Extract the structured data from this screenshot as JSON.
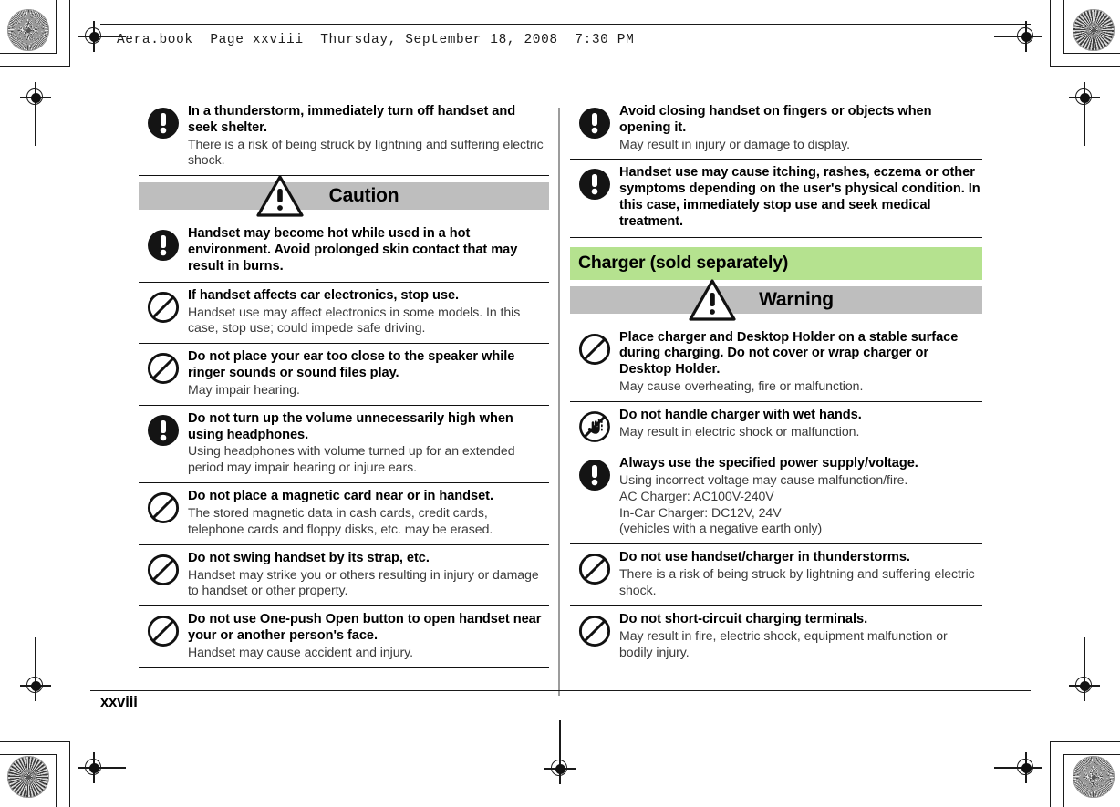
{
  "page": {
    "file_header": "Aera.book  Page xxviii  Thursday, September 18, 2008  7:30 PM",
    "folio": "xxviii"
  },
  "left_column": {
    "entries_top": [
      {
        "icon": "mandatory-exclamation-icon",
        "title": "In a thunderstorm, immediately turn off handset and seek shelter.",
        "desc": "There is a risk of being struck by lightning and suffering electric shock."
      }
    ],
    "caution_bar": {
      "label": "Caution",
      "icon": "caution-triangle-icon",
      "background": "#bebebe"
    },
    "entries_caution": [
      {
        "icon": "mandatory-exclamation-icon",
        "title": "Handset may become hot while used in a hot environment. Avoid prolonged skin contact that may result in burns.",
        "desc": ""
      },
      {
        "icon": "prohibition-icon",
        "title": "If handset affects car electronics, stop use.",
        "desc": "Handset use may affect electronics in some models. In this case, stop use; could impede safe driving."
      },
      {
        "icon": "prohibition-icon",
        "title": "Do not place your ear too close to the speaker while ringer sounds or sound files play.",
        "desc": "May impair hearing."
      },
      {
        "icon": "mandatory-exclamation-icon",
        "title": "Do not turn up the volume unnecessarily high when using headphones.",
        "desc": "Using headphones with volume turned up for an extended period may impair hearing or injure ears."
      },
      {
        "icon": "prohibition-icon",
        "title": "Do not place a magnetic card near or in handset.",
        "desc": "The stored magnetic data in cash cards, credit cards, telephone cards and floppy disks, etc. may be erased."
      },
      {
        "icon": "prohibition-icon",
        "title": "Do not swing handset by its strap, etc.",
        "desc": "Handset may strike you or others resulting in injury or damage to handset or other property."
      },
      {
        "icon": "prohibition-icon",
        "title": "Do not use One-push Open button to open handset near your or another person's face.",
        "desc": "Handset may cause accident and injury."
      }
    ]
  },
  "right_column": {
    "entries_top": [
      {
        "icon": "mandatory-exclamation-icon",
        "title": "Avoid closing handset on fingers or objects when opening it.",
        "desc": "May result in injury or damage to display."
      },
      {
        "icon": "mandatory-exclamation-icon",
        "title": "Handset use may cause itching, rashes, eczema or other symptoms depending on the user's physical condition. In this case, immediately stop use and seek medical treatment.",
        "desc": ""
      }
    ],
    "section_bar": {
      "label": "Charger (sold separately)",
      "background": "#b5e28f"
    },
    "warning_bar": {
      "label": "Warning",
      "icon": "caution-triangle-icon",
      "background": "#bebebe"
    },
    "entries_warning": [
      {
        "icon": "prohibition-icon",
        "title": "Place charger and Desktop Holder on a stable surface during charging. Do not cover or wrap charger or Desktop Holder.",
        "desc": "May cause overheating, fire or malfunction."
      },
      {
        "icon": "wet-hands-prohibition-icon",
        "title": "Do not handle charger with wet hands.",
        "desc": "May result in electric shock or malfunction."
      },
      {
        "icon": "mandatory-exclamation-icon",
        "title": "Always use the specified power supply/voltage.",
        "desc": "Using incorrect voltage may cause malfunction/fire.\nAC Charger: AC100V-240V\nIn-Car Charger: DC12V, 24V\n(vehicles with a negative earth only)"
      },
      {
        "icon": "prohibition-icon",
        "title": "Do not use handset/charger in thunderstorms.",
        "desc": "There is a risk of being struck by lightning and suffering electric shock."
      },
      {
        "icon": "prohibition-icon",
        "title": "Do not short-circuit charging terminals.",
        "desc": "May result in fire, electric shock, equipment malfunction or bodily injury."
      }
    ]
  }
}
